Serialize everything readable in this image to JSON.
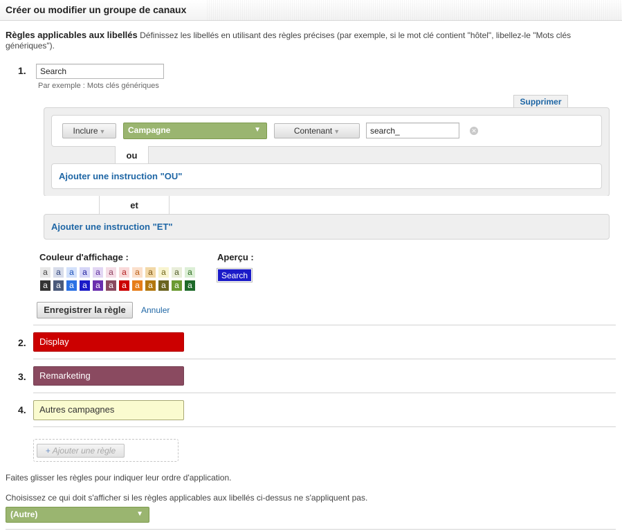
{
  "header": {
    "title": "Créer ou modifier un groupe de canaux"
  },
  "intro": {
    "bold": "Règles applicables aux libellés",
    "text": " Définissez les libellés en utilisant des règles précises (par exemple, si le mot clé contient \"hôtel\", libellez-le \"Mots clés génériques\")."
  },
  "rule1": {
    "number": "1.",
    "name_value": "Search",
    "example": "Par exemple : Mots clés génériques",
    "delete_tab": "Supprimer",
    "condition": {
      "include": "Inclure",
      "dimension": "Campagne",
      "operator": "Contenant",
      "value": "search_"
    },
    "or_label": "ou",
    "add_or": "Ajouter une instruction \"OU\"",
    "and_label": "et",
    "add_and": "Ajouter une instruction \"ET\"",
    "color_label": "Couleur d'affichage :",
    "preview_label": "Aperçu :",
    "preview_text": "Search",
    "preview_color": "#1b1bc8",
    "swatch_letter": "a",
    "swatches_light": [
      {
        "bg": "#e8e8e8",
        "fg": "#444"
      },
      {
        "bg": "#d7dcea",
        "fg": "#2a3e78"
      },
      {
        "bg": "#d3e1fb",
        "fg": "#1b4fb8"
      },
      {
        "bg": "#d6d6f7",
        "fg": "#1c1c9c"
      },
      {
        "bg": "#e2d6f3",
        "fg": "#5c2a9c"
      },
      {
        "bg": "#f5dde6",
        "fg": "#8a3c5a"
      },
      {
        "bg": "#f9d9d9",
        "fg": "#b01c1c"
      },
      {
        "bg": "#fbe0cc",
        "fg": "#b85a10"
      },
      {
        "bg": "#f2d8a7",
        "fg": "#7a5410"
      },
      {
        "bg": "#f8f4cf",
        "fg": "#6e6418"
      },
      {
        "bg": "#e9eeda",
        "fg": "#505a26"
      },
      {
        "bg": "#dcefd6",
        "fg": "#2a6a1c"
      }
    ],
    "swatches_dark": [
      {
        "bg": "#333333",
        "fg": "#fff"
      },
      {
        "bg": "#4b5a7a",
        "fg": "#fff"
      },
      {
        "bg": "#2b71e4",
        "fg": "#fff"
      },
      {
        "bg": "#1b1bc8",
        "fg": "#fff"
      },
      {
        "bg": "#6a2fae",
        "fg": "#fff"
      },
      {
        "bg": "#8a4a60",
        "fg": "#fff"
      },
      {
        "bg": "#cc0000",
        "fg": "#fff"
      },
      {
        "bg": "#e67e1a",
        "fg": "#fff"
      },
      {
        "bg": "#b2770f",
        "fg": "#fff"
      },
      {
        "bg": "#6b6420",
        "fg": "#fff"
      },
      {
        "bg": "#6a9a32",
        "fg": "#fff"
      },
      {
        "bg": "#1e6a2a",
        "fg": "#fff"
      }
    ],
    "save": "Enregistrer la règle",
    "cancel": "Annuler"
  },
  "rules": [
    {
      "number": "2.",
      "label": "Display",
      "bg": "#cc0000",
      "fg": "#ffffff",
      "border": "#b30000"
    },
    {
      "number": "3.",
      "label": "Remarketing",
      "bg": "#8a4a60",
      "fg": "#ffffff",
      "border": "#744052"
    },
    {
      "number": "4.",
      "label": "Autres campagnes",
      "bg": "#fafbcf",
      "fg": "#333333",
      "border": "#a8a874"
    }
  ],
  "add_rule": {
    "plus": "+",
    "label": "Ajouter une règle"
  },
  "drag_note": "Faites glisser les règles pour indiquer leur ordre d'application.",
  "fallback_note": "Choisissez ce qui doit s'afficher si les règles applicables aux libellés ci-dessus ne s'appliquent pas.",
  "fallback_select": "(Autre)"
}
